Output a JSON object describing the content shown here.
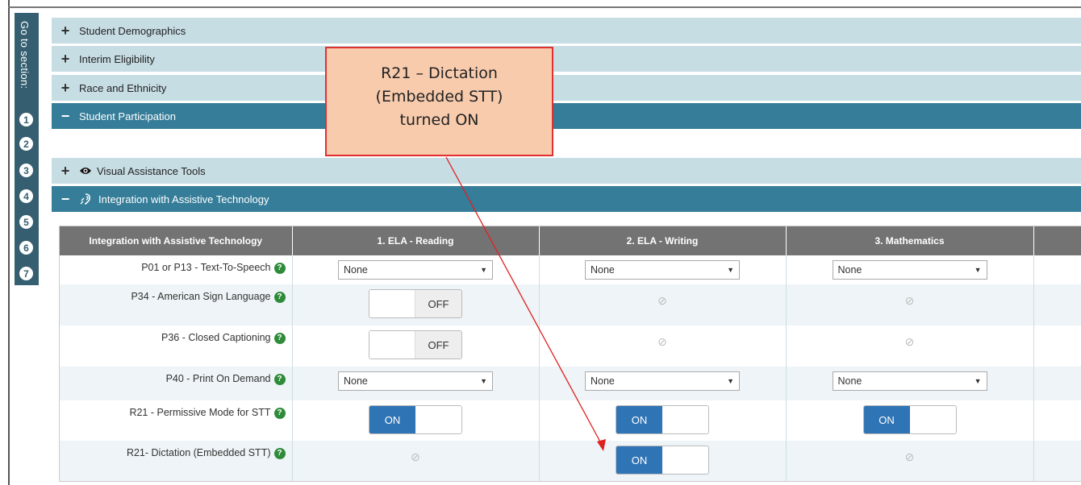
{
  "sidebar": {
    "label": "Go to section:",
    "numbers": [
      "1",
      "2",
      "3",
      "4",
      "5",
      "6",
      "7"
    ]
  },
  "sections": {
    "demographics": "Student Demographics",
    "interim": "Interim Eligibility",
    "race": "Race and Ethnicity",
    "participation": "Student Participation",
    "visual": "Visual Assistance Tools",
    "integration": "Integration with Assistive Technology"
  },
  "table": {
    "headers": [
      "Integration with Assistive Technology",
      "1. ELA - Reading",
      "2. ELA - Writing",
      "3. Mathematics"
    ],
    "rows": [
      {
        "label": "P01 or P13 - Text-To-Speech"
      },
      {
        "label": "P34 - American Sign Language"
      },
      {
        "label": "P36 - Closed Captioning"
      },
      {
        "label": "P40 - Print On Demand"
      },
      {
        "label": "R21 - Permissive Mode for STT"
      },
      {
        "label": "R21- Dictation (Embedded STT)"
      }
    ],
    "select_value": "None",
    "on_label": "ON",
    "off_label": "OFF",
    "help_glyph": "?",
    "na_glyph": "⊘"
  },
  "callout": {
    "lines": [
      "R21 – Dictation",
      "(Embedded STT)",
      "turned ON"
    ]
  },
  "colors": {
    "section_collapsed": "#c7dde4",
    "section_open": "#357d99",
    "toggle_on": "#2f74b5",
    "callout_fill": "#f8cbad",
    "callout_border": "#e03030"
  }
}
